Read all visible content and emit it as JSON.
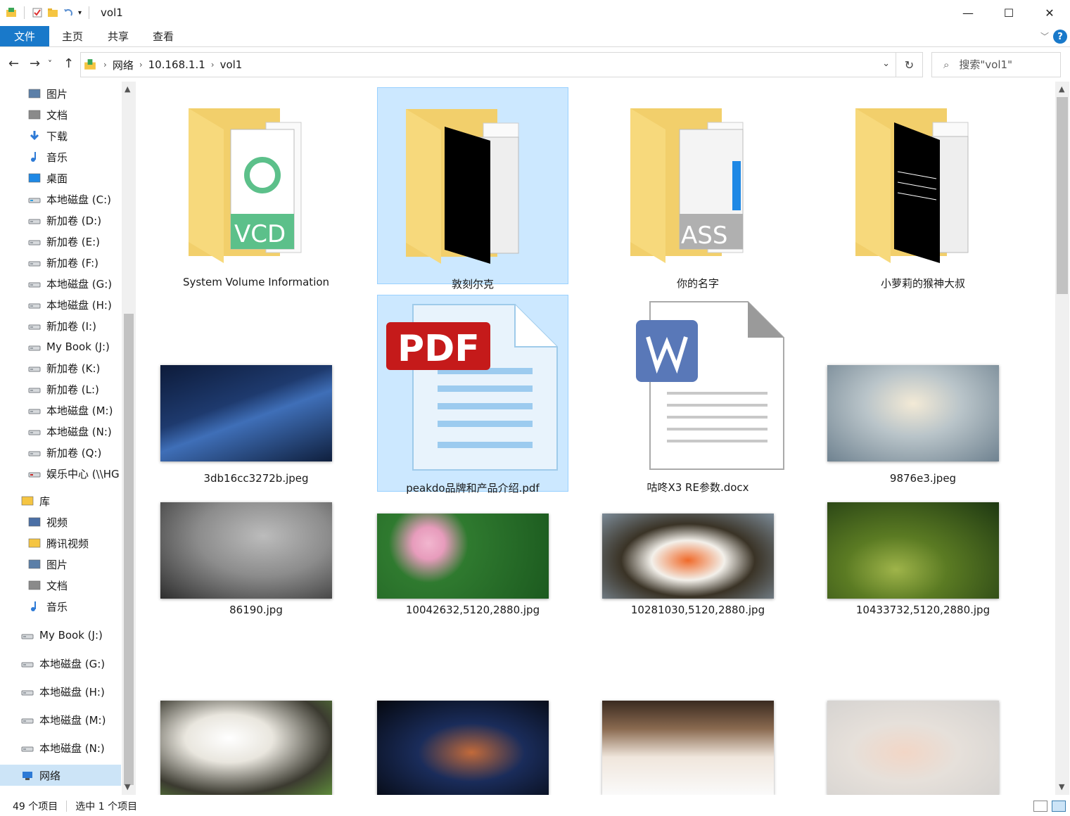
{
  "title": "vol1",
  "window_controls": {
    "minimize": "—",
    "maximize": "☐",
    "close": "✕"
  },
  "ribbon": {
    "file": "文件",
    "home": "主页",
    "share": "共享",
    "view": "查看",
    "expand": "﹀",
    "help": "?"
  },
  "nav_buttons": {
    "back": "←",
    "forward": "→",
    "recent": "˅",
    "up": "↑"
  },
  "breadcrumb": [
    "网络",
    "10.168.1.1",
    "vol1"
  ],
  "breadcrumb_sep": "›",
  "address_dropdown": "⌄",
  "refresh": "↻",
  "search": {
    "placeholder": "搜索\"vol1\"",
    "icon": "⌕"
  },
  "sidebar": {
    "items": [
      {
        "label": "图片",
        "icon": "pictures-icon"
      },
      {
        "label": "文档",
        "icon": "documents-icon"
      },
      {
        "label": "下载",
        "icon": "download-icon"
      },
      {
        "label": "音乐",
        "icon": "music-icon"
      },
      {
        "label": "桌面",
        "icon": "desktop-icon"
      },
      {
        "label": "本地磁盘 (C:)",
        "icon": "windows-drive-icon"
      },
      {
        "label": "新加卷 (D:)",
        "icon": "drive-icon"
      },
      {
        "label": "新加卷 (E:)",
        "icon": "drive-icon"
      },
      {
        "label": "新加卷 (F:)",
        "icon": "drive-icon"
      },
      {
        "label": "本地磁盘 (G:)",
        "icon": "drive-icon"
      },
      {
        "label": "本地磁盘 (H:)",
        "icon": "drive-icon"
      },
      {
        "label": "新加卷 (I:)",
        "icon": "drive-icon"
      },
      {
        "label": "My Book (J:)",
        "icon": "drive-icon"
      },
      {
        "label": "新加卷 (K:)",
        "icon": "drive-icon"
      },
      {
        "label": "新加卷 (L:)",
        "icon": "drive-icon"
      },
      {
        "label": "本地磁盘 (M:)",
        "icon": "drive-icon"
      },
      {
        "label": "本地磁盘 (N:)",
        "icon": "drive-icon"
      },
      {
        "label": "新加卷 (Q:)",
        "icon": "drive-icon"
      },
      {
        "label": "娱乐中心 (\\\\HG",
        "icon": "network-drive-disconnected-icon"
      },
      {
        "label": "库",
        "icon": "library-icon"
      },
      {
        "label": "视频",
        "icon": "videos-icon"
      },
      {
        "label": "腾讯视频",
        "icon": "folder-icon"
      },
      {
        "label": "图片",
        "icon": "pictures-icon"
      },
      {
        "label": "文档",
        "icon": "documents-icon"
      },
      {
        "label": "音乐",
        "icon": "music-icon"
      },
      {
        "label": "My Book (J:)",
        "icon": "drive-icon"
      },
      {
        "label": "本地磁盘 (G:)",
        "icon": "drive-icon"
      },
      {
        "label": "本地磁盘 (H:)",
        "icon": "drive-icon"
      },
      {
        "label": "本地磁盘 (M:)",
        "icon": "drive-icon"
      },
      {
        "label": "本地磁盘 (N:)",
        "icon": "drive-icon"
      },
      {
        "label": "网络",
        "icon": "network-icon",
        "selected": true
      }
    ]
  },
  "files": [
    {
      "name": "System Volume Information",
      "type": "folder",
      "preview": "vcd"
    },
    {
      "name": "敦刻尔克",
      "type": "folder",
      "preview": "black",
      "selected": true
    },
    {
      "name": "你的名字",
      "type": "folder",
      "preview": "ass"
    },
    {
      "name": "小萝莉的猴神大叔",
      "type": "folder",
      "preview": "black-text"
    },
    {
      "name": "3db16cc3272b.jpeg",
      "type": "image"
    },
    {
      "name": "peakdo品牌和产品介绍.pdf",
      "type": "pdf",
      "selected": true,
      "badge": "PDF"
    },
    {
      "name": "咕咚X3 RE参数.docx",
      "type": "docx",
      "badge": "W"
    },
    {
      "name": "9876e3.jpeg",
      "type": "image"
    },
    {
      "name": "86190.jpg",
      "type": "image"
    },
    {
      "name": "10042632,5120,2880.jpg",
      "type": "image"
    },
    {
      "name": "10281030,5120,2880.jpg",
      "type": "image"
    },
    {
      "name": "10433732,5120,2880.jpg",
      "type": "image"
    },
    {
      "name": "",
      "type": "image"
    },
    {
      "name": "",
      "type": "image"
    },
    {
      "name": "",
      "type": "image"
    },
    {
      "name": "",
      "type": "image"
    }
  ],
  "status": {
    "count": "49 个项目",
    "selection": "选中 1 个项目"
  },
  "colors": {
    "accent": "#1979ca",
    "selected_bg": "#cce8ff",
    "selected_border": "#99d1ff",
    "folder": "#f5d477"
  }
}
